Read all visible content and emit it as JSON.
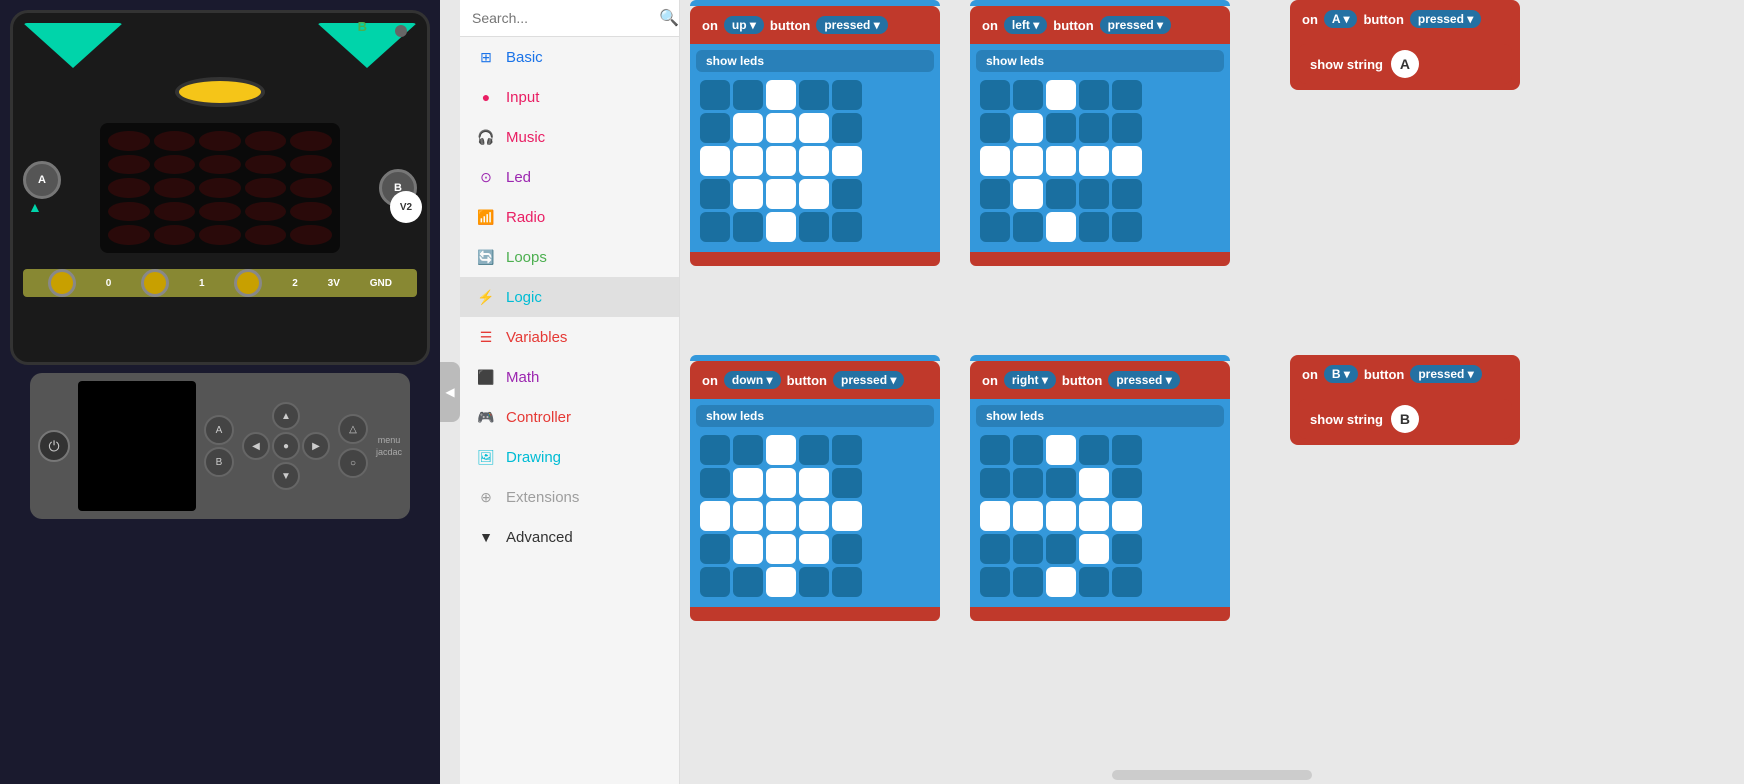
{
  "search": {
    "placeholder": "Search..."
  },
  "sidebar": {
    "items": [
      {
        "id": "basic",
        "label": "Basic",
        "color": "#1a73e8",
        "icon": "grid"
      },
      {
        "id": "input",
        "label": "Input",
        "color": "#e91e63",
        "icon": "circle"
      },
      {
        "id": "music",
        "label": "Music",
        "color": "#e91e63",
        "icon": "headphone"
      },
      {
        "id": "led",
        "label": "Led",
        "color": "#9c27b0",
        "icon": "toggle"
      },
      {
        "id": "radio",
        "label": "Radio",
        "color": "#e91e63",
        "icon": "signal"
      },
      {
        "id": "loops",
        "label": "Loops",
        "color": "#4caf50",
        "icon": "refresh"
      },
      {
        "id": "logic",
        "label": "Logic",
        "color": "#00bcd4",
        "icon": "branch",
        "active": true
      },
      {
        "id": "variables",
        "label": "Variables",
        "color": "#e53935",
        "icon": "list"
      },
      {
        "id": "math",
        "label": "Math",
        "color": "#9c27b0",
        "icon": "calculator"
      },
      {
        "id": "controller",
        "label": "Controller",
        "color": "#e53935",
        "icon": "gamepad"
      },
      {
        "id": "drawing",
        "label": "Drawing",
        "color": "#00bcd4",
        "icon": "image"
      },
      {
        "id": "extensions",
        "label": "Extensions",
        "color": "#9e9e9e",
        "icon": "plus-circle"
      },
      {
        "id": "advanced",
        "label": "Advanced",
        "color": "#333",
        "icon": "chevron-down"
      }
    ]
  },
  "blocks": {
    "up_block": {
      "header": "on up ▾ button pressed ▾",
      "on_label": "on",
      "direction": "up",
      "action": "button pressed",
      "leds": [
        [
          0,
          0,
          1,
          0,
          0
        ],
        [
          0,
          1,
          1,
          1,
          0
        ],
        [
          1,
          1,
          1,
          1,
          1
        ],
        [
          0,
          1,
          1,
          1,
          0
        ],
        [
          0,
          0,
          1,
          0,
          0
        ]
      ],
      "show_leds_label": "show leds"
    },
    "left_block": {
      "on_label": "on",
      "direction": "left",
      "action": "button pressed",
      "leds": [
        [
          0,
          0,
          1,
          0,
          0
        ],
        [
          0,
          1,
          0,
          0,
          0
        ],
        [
          1,
          1,
          1,
          1,
          1
        ],
        [
          0,
          1,
          0,
          0,
          0
        ],
        [
          0,
          0,
          1,
          0,
          0
        ]
      ],
      "show_leds_label": "show leds"
    },
    "a_block": {
      "on_label": "on",
      "button": "A",
      "action": "button pressed",
      "show_string_label": "show string",
      "value": "A"
    },
    "down_block": {
      "on_label": "on",
      "direction": "down",
      "action": "button pressed",
      "leds": [
        [
          0,
          0,
          1,
          0,
          0
        ],
        [
          0,
          1,
          1,
          1,
          0
        ],
        [
          1,
          1,
          1,
          1,
          1
        ],
        [
          0,
          1,
          1,
          1,
          0
        ],
        [
          0,
          0,
          1,
          0,
          0
        ]
      ],
      "show_leds_label": "show leds"
    },
    "right_block": {
      "on_label": "on",
      "direction": "right",
      "action": "button pressed",
      "leds": [
        [
          0,
          0,
          1,
          0,
          0
        ],
        [
          0,
          0,
          0,
          1,
          0
        ],
        [
          1,
          1,
          1,
          1,
          1
        ],
        [
          0,
          0,
          0,
          1,
          0
        ],
        [
          0,
          0,
          1,
          0,
          0
        ]
      ],
      "show_leds_label": "show leds"
    },
    "b_block": {
      "on_label": "on",
      "button": "B",
      "action": "button pressed",
      "show_string_label": "show string",
      "value": "B"
    }
  },
  "controller": {
    "menu_label": "menu",
    "jacdac_label": "jacdac"
  },
  "scrollbar": {}
}
